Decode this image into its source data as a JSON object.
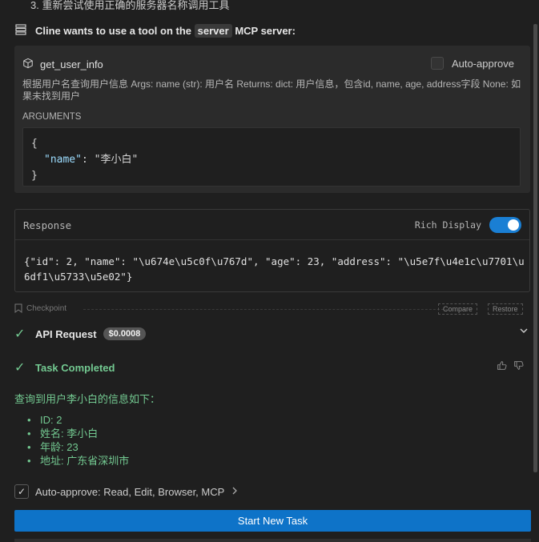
{
  "top_list_item": "3. 重新尝试使用正确的服务器名称调用工具",
  "mcp_request": {
    "prefix": "Cline wants to use a tool on the",
    "server": "server",
    "suffix": "MCP server:"
  },
  "tool": {
    "name": "get_user_info",
    "auto_approve_label": "Auto-approve",
    "auto_approve_checked": false,
    "description": "根据用户名查询用户信息 Args: name (str): 用户名 Returns: dict: 用户信息，包含id, name, age, address字段 None: 如果未找到用户",
    "arguments_label": "ARGUMENTS",
    "arguments": {
      "open": "{",
      "key": "\"name\"",
      "sep": ": ",
      "value": "\"李小白\"",
      "close": "}"
    }
  },
  "response": {
    "title": "Response",
    "rich_display_label": "Rich Display",
    "rich_display_on": true,
    "body": "{\"id\": 2, \"name\": \"\\u674e\\u5c0f\\u767d\", \"age\": 23, \"address\": \"\\u5e7f\\u4e1c\\u7701\\u6df1\\u5733\\u5e02\"}"
  },
  "checkpoint": {
    "label": "Checkpoint",
    "compare": "Compare",
    "restore": "Restore"
  },
  "api_request": {
    "label": "API Request",
    "cost": "$0.0008"
  },
  "task": {
    "label": "Task Completed"
  },
  "result": {
    "intro": "查询到用户李小白的信息如下：",
    "items": [
      "ID: 2",
      "姓名: 李小白",
      "年龄: 23",
      "地址: 广东省深圳市"
    ]
  },
  "footer": {
    "auto_approve_label": "Auto-approve:",
    "auto_approve_value": "Read, Edit, Browser, MCP",
    "start_button": "Start New Task"
  },
  "colors": {
    "accent": "#0e73c8",
    "success": "#73c991",
    "background": "#1f1f1f",
    "card": "#2b2b2b"
  },
  "icons": [
    "server-icon",
    "cube-icon",
    "bookmark-icon",
    "check-icon",
    "chevron-down-icon",
    "thumbs-up-icon",
    "thumbs-down-icon",
    "chevron-right-icon"
  ]
}
